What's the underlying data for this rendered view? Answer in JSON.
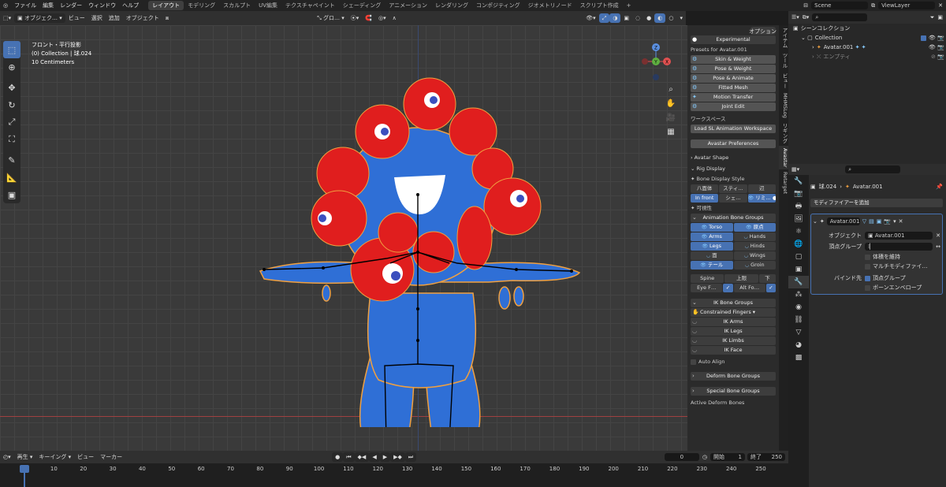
{
  "menu": {
    "items": [
      "ファイル",
      "編集",
      "レンダー",
      "ウィンドウ",
      "ヘルプ"
    ],
    "workspaces": [
      "レイアウト",
      "モデリング",
      "スカルプト",
      "UV編集",
      "テクスチャペイント",
      "シェーディング",
      "アニメーション",
      "レンダリング",
      "コンポジティング",
      "ジオメトリノード",
      "スクリプト作成"
    ],
    "active_workspace": "レイアウト",
    "add_workspace": "+",
    "scene": "Scene",
    "view_layer": "ViewLayer"
  },
  "viewport_header": {
    "mode": "オブジェク…",
    "menus": [
      "ビュー",
      "選択",
      "追加",
      "オブジェクト"
    ],
    "transform": "グロ…",
    "options": "オプション"
  },
  "viewport": {
    "overlay_line1": "フロント・平行投影",
    "overlay_line2": "(0) Collection | 球.024",
    "overlay_line3": "10 Centimeters",
    "gizmo": {
      "z": "Z",
      "y": "Y",
      "x": "X"
    }
  },
  "npanel": {
    "experimental": "Experimental",
    "presets_label": "Presets for  Avatar.001",
    "preset_buttons": [
      "Skin & Weight",
      "Pose & Weight",
      "Pose & Animate",
      "Fitted Mesh",
      "Motion Transfer",
      "Joint Edit"
    ],
    "workspace_label": "ワークスペース",
    "load_workspace": "Load SL Animation Workspace",
    "preferences": "Avastar Preferences",
    "avatar_shape": "Avatar Shape",
    "rig_display": "Rig Display",
    "bone_display_style": "Bone Display Style",
    "style_buttons": [
      "八面体",
      "スティ…",
      "辺"
    ],
    "infront_row": [
      "In front",
      "シェ…",
      "リミ…"
    ],
    "visibility": "可視性",
    "anim_bone_groups": "Animation Bone Groups",
    "anim_groups": [
      [
        "Torso",
        "原点"
      ],
      [
        "Arms",
        "Hands"
      ],
      [
        "Legs",
        "Hinds"
      ],
      [
        "面",
        "Wings"
      ],
      [
        "テール",
        "Groin"
      ]
    ],
    "anim_groups_on": [
      [
        true,
        true
      ],
      [
        true,
        false
      ],
      [
        true,
        false
      ],
      [
        false,
        false
      ],
      [
        true,
        false
      ]
    ],
    "spine_row": [
      "Spine",
      "上限",
      "下"
    ],
    "eye_row": [
      "Eye F…",
      "Alt Fo…"
    ],
    "ik_bone_groups": "IK Bone Groups",
    "constrained_fingers": "Constrained Fingers",
    "ik_items": [
      "IK Arms",
      "IK Legs",
      "IK Limbs",
      "IK Face"
    ],
    "auto_align": "Auto Align",
    "deform_bone_groups": "Deform Bone Groups",
    "special_bone_groups": "Special Bone Groups",
    "active_deform": "Active Deform Bones"
  },
  "vertical_tabs": [
    "アイテム",
    "ツール",
    "ビュー",
    "MHMSLog",
    "リギング",
    "Avastar",
    "Retarget"
  ],
  "vertical_tabs_active": "Avastar",
  "outliner": {
    "title": "シーンコレクション",
    "collection": "Collection",
    "items": [
      "Avatar.001",
      "エンプティ"
    ]
  },
  "properties": {
    "object_name": "球.024",
    "armature_name": "Avatar.001",
    "add_modifier": "モディファイアーを追加",
    "modifier_name": "Avatar.001",
    "object_label": "オブジェクト",
    "object_value": "Avatar.001",
    "vertex_group_label": "頂点グループ",
    "preserve_volume": "体積を維持",
    "multi_modifier": "マルチモディファイ…",
    "bind_to_label": "バインド先",
    "bind_vertex_groups": "頂点グループ",
    "bind_bone_envelopes": "ボーンエンベロープ"
  },
  "timeline": {
    "playback": "再生",
    "keying": "キーイング",
    "view": "ビュー",
    "marker": "マーカー",
    "current_frame": "0",
    "start_label": "開始",
    "start": "1",
    "end_label": "終了",
    "end": "250",
    "ruler_ticks": [
      "0",
      "10",
      "20",
      "30",
      "40",
      "50",
      "60",
      "70",
      "80",
      "90",
      "100",
      "110",
      "120",
      "130",
      "140",
      "150",
      "160",
      "170",
      "180",
      "190",
      "200",
      "210",
      "220",
      "230",
      "240",
      "250"
    ]
  },
  "colors": {
    "accent": "#4772b3",
    "mascot_blue": "#2f6fd6",
    "mascot_red": "#e01e1e",
    "selection_outline": "#f0a040"
  }
}
